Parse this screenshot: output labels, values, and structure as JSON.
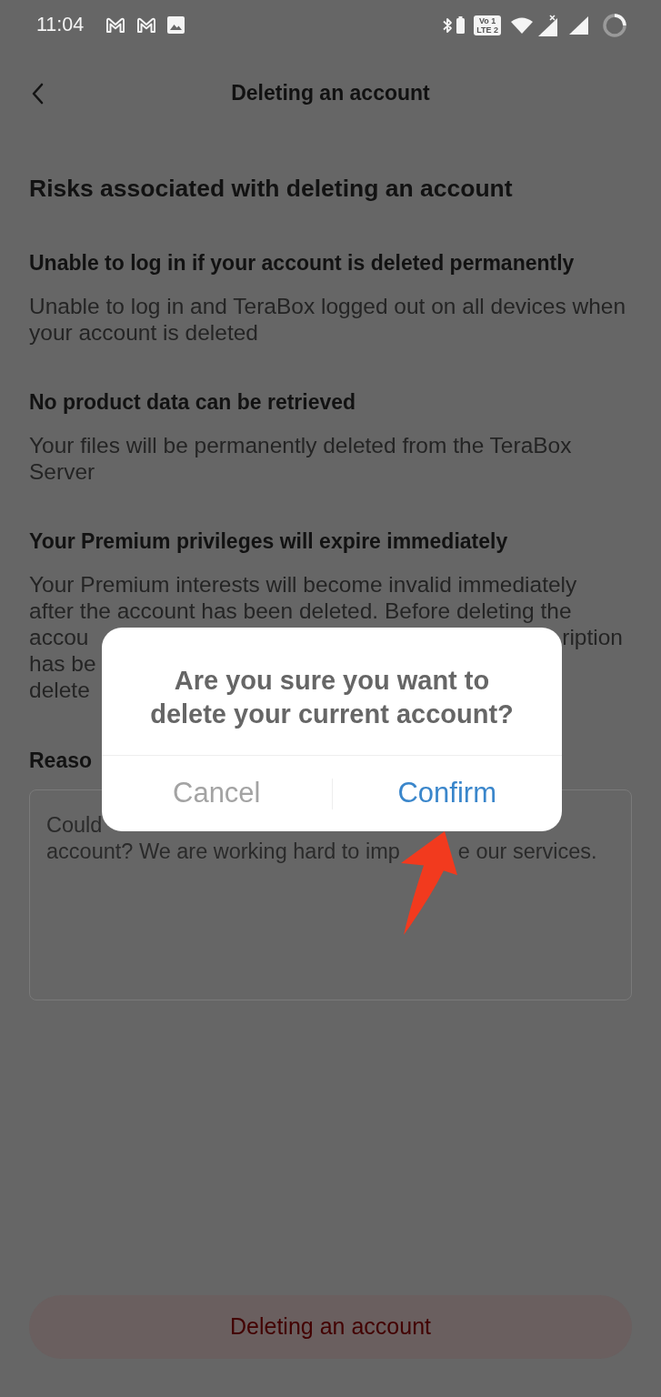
{
  "status_bar": {
    "time": "11:04",
    "network_badge": [
      "Vo 1",
      "LTE 2"
    ]
  },
  "header": {
    "title": "Deleting an account"
  },
  "heading": "Risks associated with deleting an account",
  "risks": [
    {
      "title": "Unable to log in if your account is deleted permanently",
      "description": "Unable to log in and TeraBox logged out on all devices when your account is deleted"
    },
    {
      "title": "No product data can be retrieved",
      "description": "Your files will be permanently deleted from the TeraBox Server"
    },
    {
      "title": "Your Premium privileges will expire immediately",
      "description_lines": [
        {
          "left": "Your Premium interests will become invalid immediately"
        },
        {
          "left": "after the account has been deleted. Before deleting the"
        },
        {
          "left": "accou",
          "right": "ription"
        },
        {
          "left": "has be"
        },
        {
          "left": "delete"
        }
      ]
    }
  ],
  "reason": {
    "label": "Reaso",
    "placeholder_lines": [
      {
        "left": "Could"
      },
      {
        "left": "account? We are working hard to imp",
        "right": "e our services."
      }
    ]
  },
  "bottom_button": {
    "label": "Deleting an account"
  },
  "dialog": {
    "message": "Are you sure you want to delete your current account?",
    "buttons": [
      {
        "label": "Cancel",
        "kind": "cancel"
      },
      {
        "label": "Confirm",
        "kind": "confirm"
      }
    ]
  }
}
